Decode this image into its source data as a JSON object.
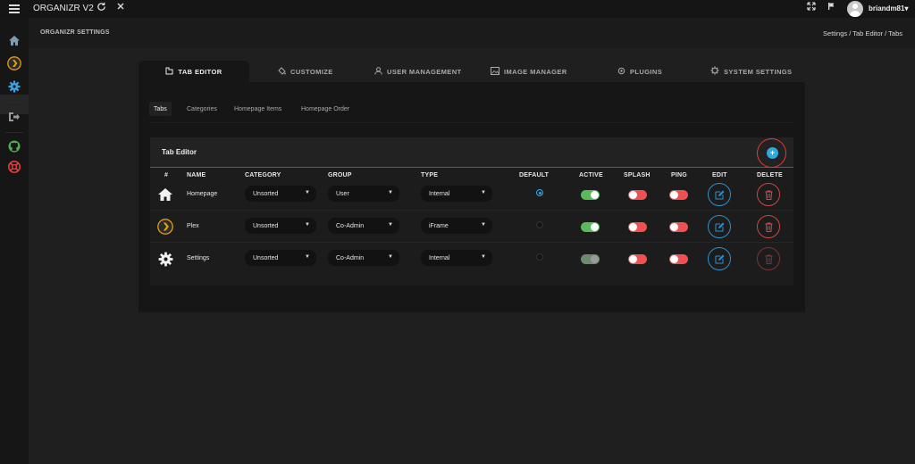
{
  "app": {
    "title": "ORGANIZR V2",
    "username": "briandm81",
    "user_caret": "▾"
  },
  "header": {
    "page_title": "ORGANIZR SETTINGS",
    "breadcrumb": "Settings / Tab Editor / Tabs"
  },
  "main_tabs": [
    {
      "label": "TAB EDITOR",
      "icon": "tab-icon",
      "active": true
    },
    {
      "label": "CUSTOMIZE",
      "icon": "paint-bucket-icon"
    },
    {
      "label": "USER MANAGEMENT",
      "icon": "user-icon"
    },
    {
      "label": "IMAGE MANAGER",
      "icon": "image-icon"
    },
    {
      "label": "PLUGINS",
      "icon": "plugin-icon"
    },
    {
      "label": "SYSTEM SETTINGS",
      "icon": "gear-icon"
    }
  ],
  "sub_tabs": [
    {
      "label": "Tabs",
      "active": true
    },
    {
      "label": "Categories"
    },
    {
      "label": "Homepage Items"
    },
    {
      "label": "Homepage Order"
    }
  ],
  "card": {
    "title": "Tab Editor",
    "add_label": "+"
  },
  "table": {
    "columns": [
      "#",
      "NAME",
      "CATEGORY",
      "GROUP",
      "TYPE",
      "DEFAULT",
      "ACTIVE",
      "SPLASH",
      "PING",
      "EDIT",
      "DELETE"
    ],
    "rows": [
      {
        "icon": "home-icon",
        "name": "Homepage",
        "category": "Unsorted",
        "group": "User",
        "type": "Internal",
        "default": true,
        "active": true,
        "splash": false,
        "ping": false
      },
      {
        "icon": "plex-icon",
        "name": "Plex",
        "category": "Unsorted",
        "group": "Co-Admin",
        "type": "iFrame",
        "default": false,
        "active": true,
        "splash": false,
        "ping": false
      },
      {
        "icon": "gear-icon",
        "name": "Settings",
        "category": "Unsorted",
        "group": "Co-Admin",
        "type": "Internal",
        "default": false,
        "active": true,
        "splash": false,
        "ping": false
      }
    ]
  },
  "colors": {
    "accent": "#2fa8e0",
    "toggle_on": "#5cb85c",
    "toggle_off": "#f05050",
    "highlight_ring": "#e03c3c"
  }
}
